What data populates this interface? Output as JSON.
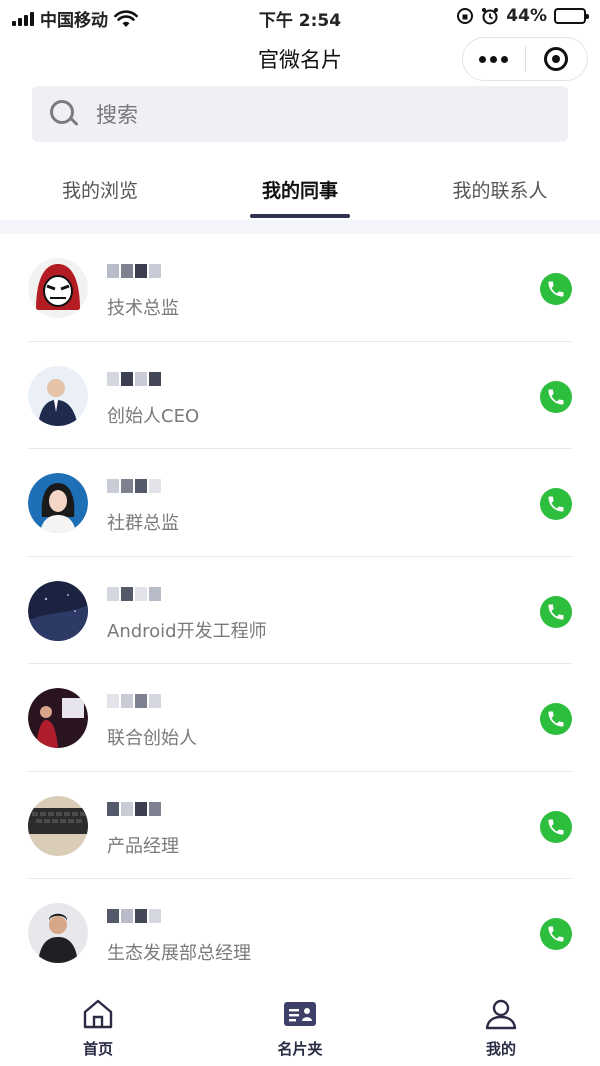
{
  "status_bar": {
    "carrier": "中国移动",
    "time": "下午 2:54",
    "battery": "44%",
    "battery_level": 0.44
  },
  "nav": {
    "title": "官微名片"
  },
  "search": {
    "placeholder": "搜索"
  },
  "tabs": [
    {
      "label": "我的浏览",
      "active": false
    },
    {
      "label": "我的同事",
      "active": true
    },
    {
      "label": "我的联系人",
      "active": false
    }
  ],
  "colleagues": [
    {
      "title": "技术总监"
    },
    {
      "title": "创始人CEO"
    },
    {
      "title": "社群总监"
    },
    {
      "title": "Android开发工程师"
    },
    {
      "title": "联合创始人"
    },
    {
      "title": "产品经理"
    },
    {
      "title": "生态发展部总经理"
    }
  ],
  "bottom_tabs": [
    {
      "label": "首页",
      "icon": "home-icon"
    },
    {
      "label": "名片夹",
      "icon": "card-holder-icon"
    },
    {
      "label": "我的",
      "icon": "user-icon"
    }
  ],
  "colors": {
    "accent": "#2f3150",
    "call_green": "#2dbe3e",
    "search_bg": "#eef0f6"
  }
}
